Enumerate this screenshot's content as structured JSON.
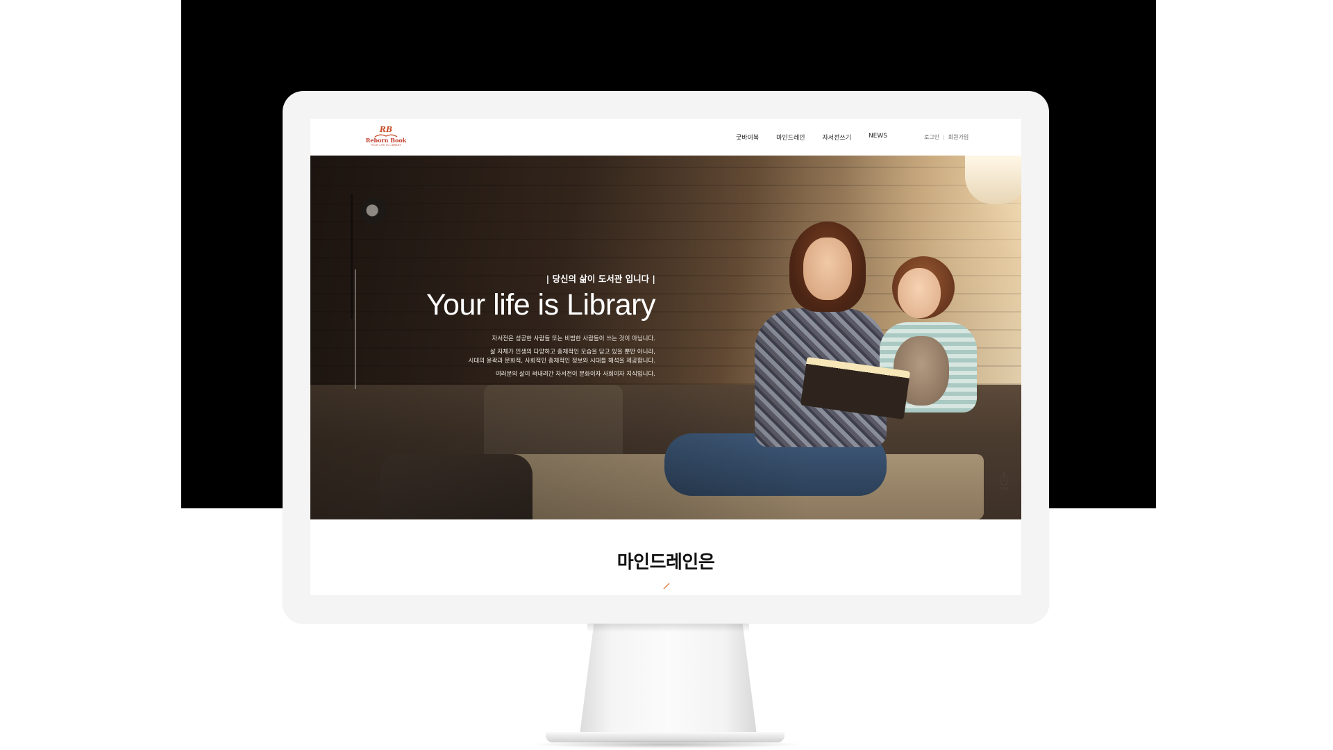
{
  "logo": {
    "mark": "RB",
    "name": "Reborn Book",
    "tagline": "YOUR LIFE IS LIBRARY"
  },
  "nav": {
    "items": [
      {
        "label": "굿바이북"
      },
      {
        "label": "마인드레인"
      },
      {
        "label": "자서전쓰기"
      },
      {
        "label": "NEWS"
      }
    ]
  },
  "user_links": {
    "login": "로그인",
    "signup": "회원가입"
  },
  "hero": {
    "subtitle": "| 당신의 삶이 도서관 입니다 |",
    "title": "Your life is Library",
    "desc_1": "자서전은 성공한 사람들 또는 비범한 사람들이 쓰는 것이 아닙니다.",
    "desc_2a": "삶 자체가 인생의 다양하고 총체적인 모습을 담고 있을 뿐만 아니라,",
    "desc_2b": "시대의 윤곽과 문화적, 사회적인 총체적인 정보와 시대를 해석을 제공합니다.",
    "desc_3": "여러분의 삶이 써내려간 자서전이 문화이자 사회이자 지식입니다.",
    "top_label": "TOP"
  },
  "section": {
    "title": "마인드레인은"
  },
  "colors": {
    "brand": "#c8502a",
    "accent_line": "#e07a3a",
    "screen_background": "#ffffff",
    "monitor_frame": "#f4f4f4",
    "backdrop": "#000000"
  }
}
